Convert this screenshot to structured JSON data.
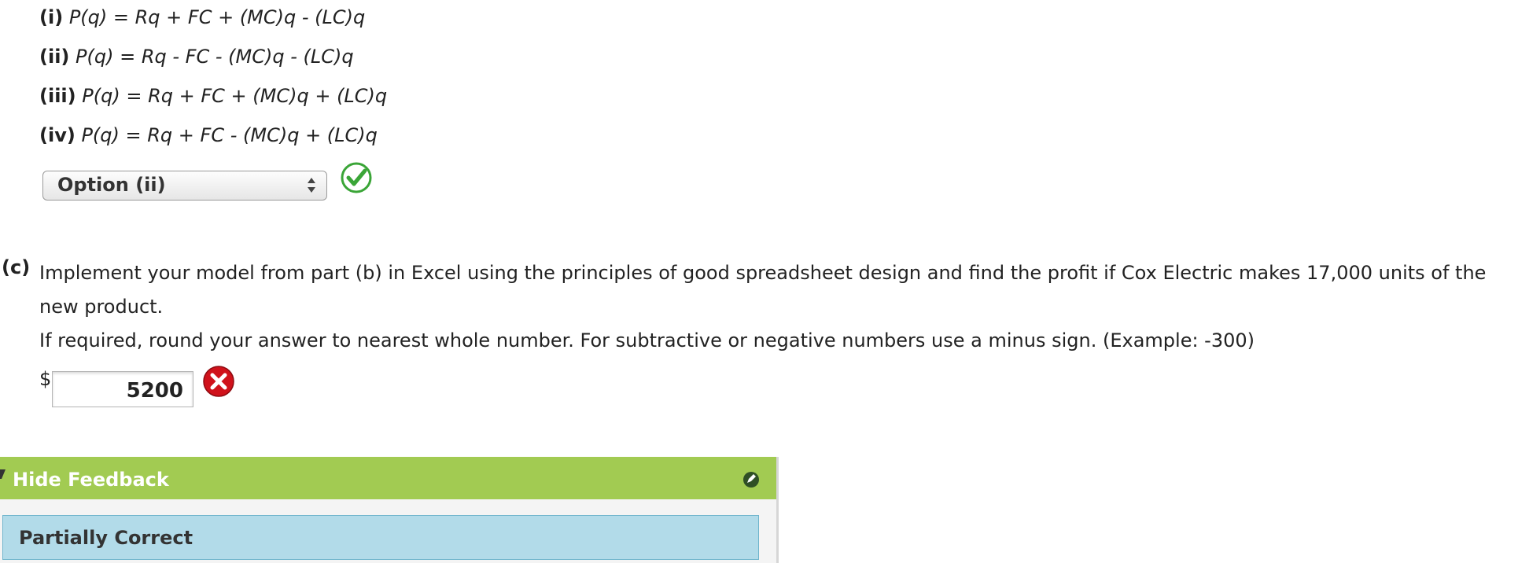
{
  "part_b": {
    "options": [
      {
        "label": "(i)",
        "formula": "P(q) = Rq + FC + (MC)q - (LC)q"
      },
      {
        "label": "(ii)",
        "formula": "P(q) = Rq - FC - (MC)q - (LC)q"
      },
      {
        "label": "(iii)",
        "formula": "P(q) = Rq + FC + (MC)q + (LC)q"
      },
      {
        "label": "(iv)",
        "formula": "P(q) = Rq + FC - (MC)q + (LC)q"
      }
    ],
    "selected_option": "Option (ii)",
    "result_icon": "check-circle-icon",
    "result_color": "#3aa537"
  },
  "part_c": {
    "label": "(c)",
    "question": "Implement your model from part (b) in Excel using the principles of good spreadsheet design and find the profit if Cox Electric makes 17,000 units of the new product.",
    "instructions": "If required, round your answer to nearest whole number. For subtractive or negative numbers use a minus sign. (Example: -300)",
    "currency_symbol": "$",
    "answer_value": "5200",
    "result_icon": "x-circle-icon",
    "result_color": "#d0121b"
  },
  "feedback": {
    "header_label": "Hide Feedback",
    "header_color": "#a2cb52",
    "status": "Partially Correct",
    "status_color": "#b2dbe9"
  }
}
